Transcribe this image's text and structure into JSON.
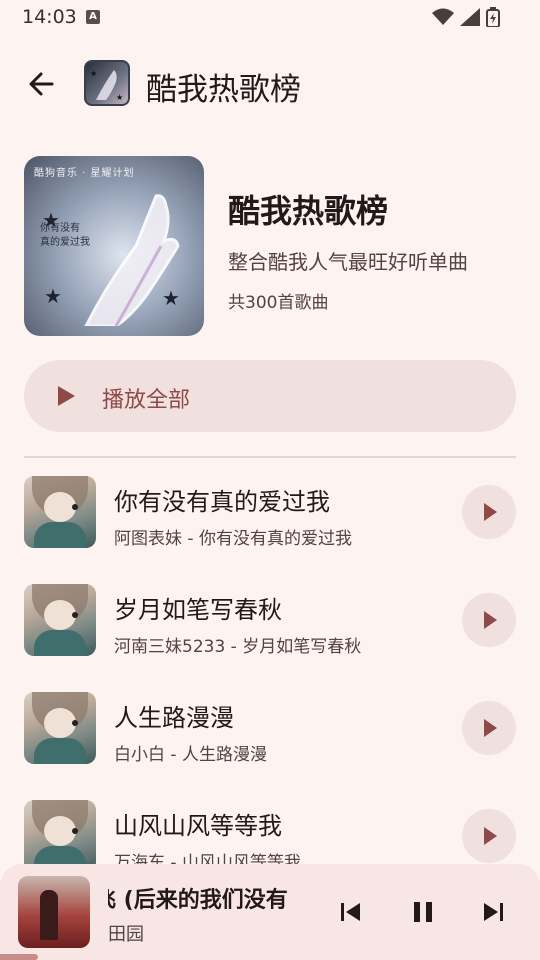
{
  "status": {
    "time": "14:03",
    "a_badge": "A"
  },
  "header": {
    "title": "酷我热歌榜"
  },
  "playlist": {
    "cover_caption": "酷狗音乐 · 星耀计划",
    "cover_script_lines": [
      "你有没有",
      "真的爱过我"
    ],
    "title": "酷我热歌榜",
    "description": "整合酷我人气最旺好听单曲",
    "count": "共300首歌曲"
  },
  "play_all": {
    "label": "播放全部"
  },
  "songs": [
    {
      "title": "你有没有真的爱过我",
      "subtitle": "阿图表妹 - 你有没有真的爱过我"
    },
    {
      "title": "岁月如笔写春秋",
      "subtitle": "河南三妹5233 - 岁月如笔写春秋"
    },
    {
      "title": "人生路漫漫",
      "subtitle": "白小白 - 人生路漫漫"
    },
    {
      "title": "山风山风等等我",
      "subtitle": "万海东 - 山风山风等等我"
    }
  ],
  "mini_player": {
    "title": "飞 (后来的我们没有",
    "artist": "田园",
    "progress_fraction": 0.07
  },
  "icons": {
    "back": "arrow-left-icon",
    "play": "play-icon",
    "prev": "skip-previous-icon",
    "pause": "pause-icon",
    "next": "skip-next-icon"
  },
  "colors": {
    "background": "#fdf3f1",
    "accent": "#8e4a49",
    "tonal_container": "#f1e1de",
    "mini_player_bg": "#f7e6e3"
  }
}
